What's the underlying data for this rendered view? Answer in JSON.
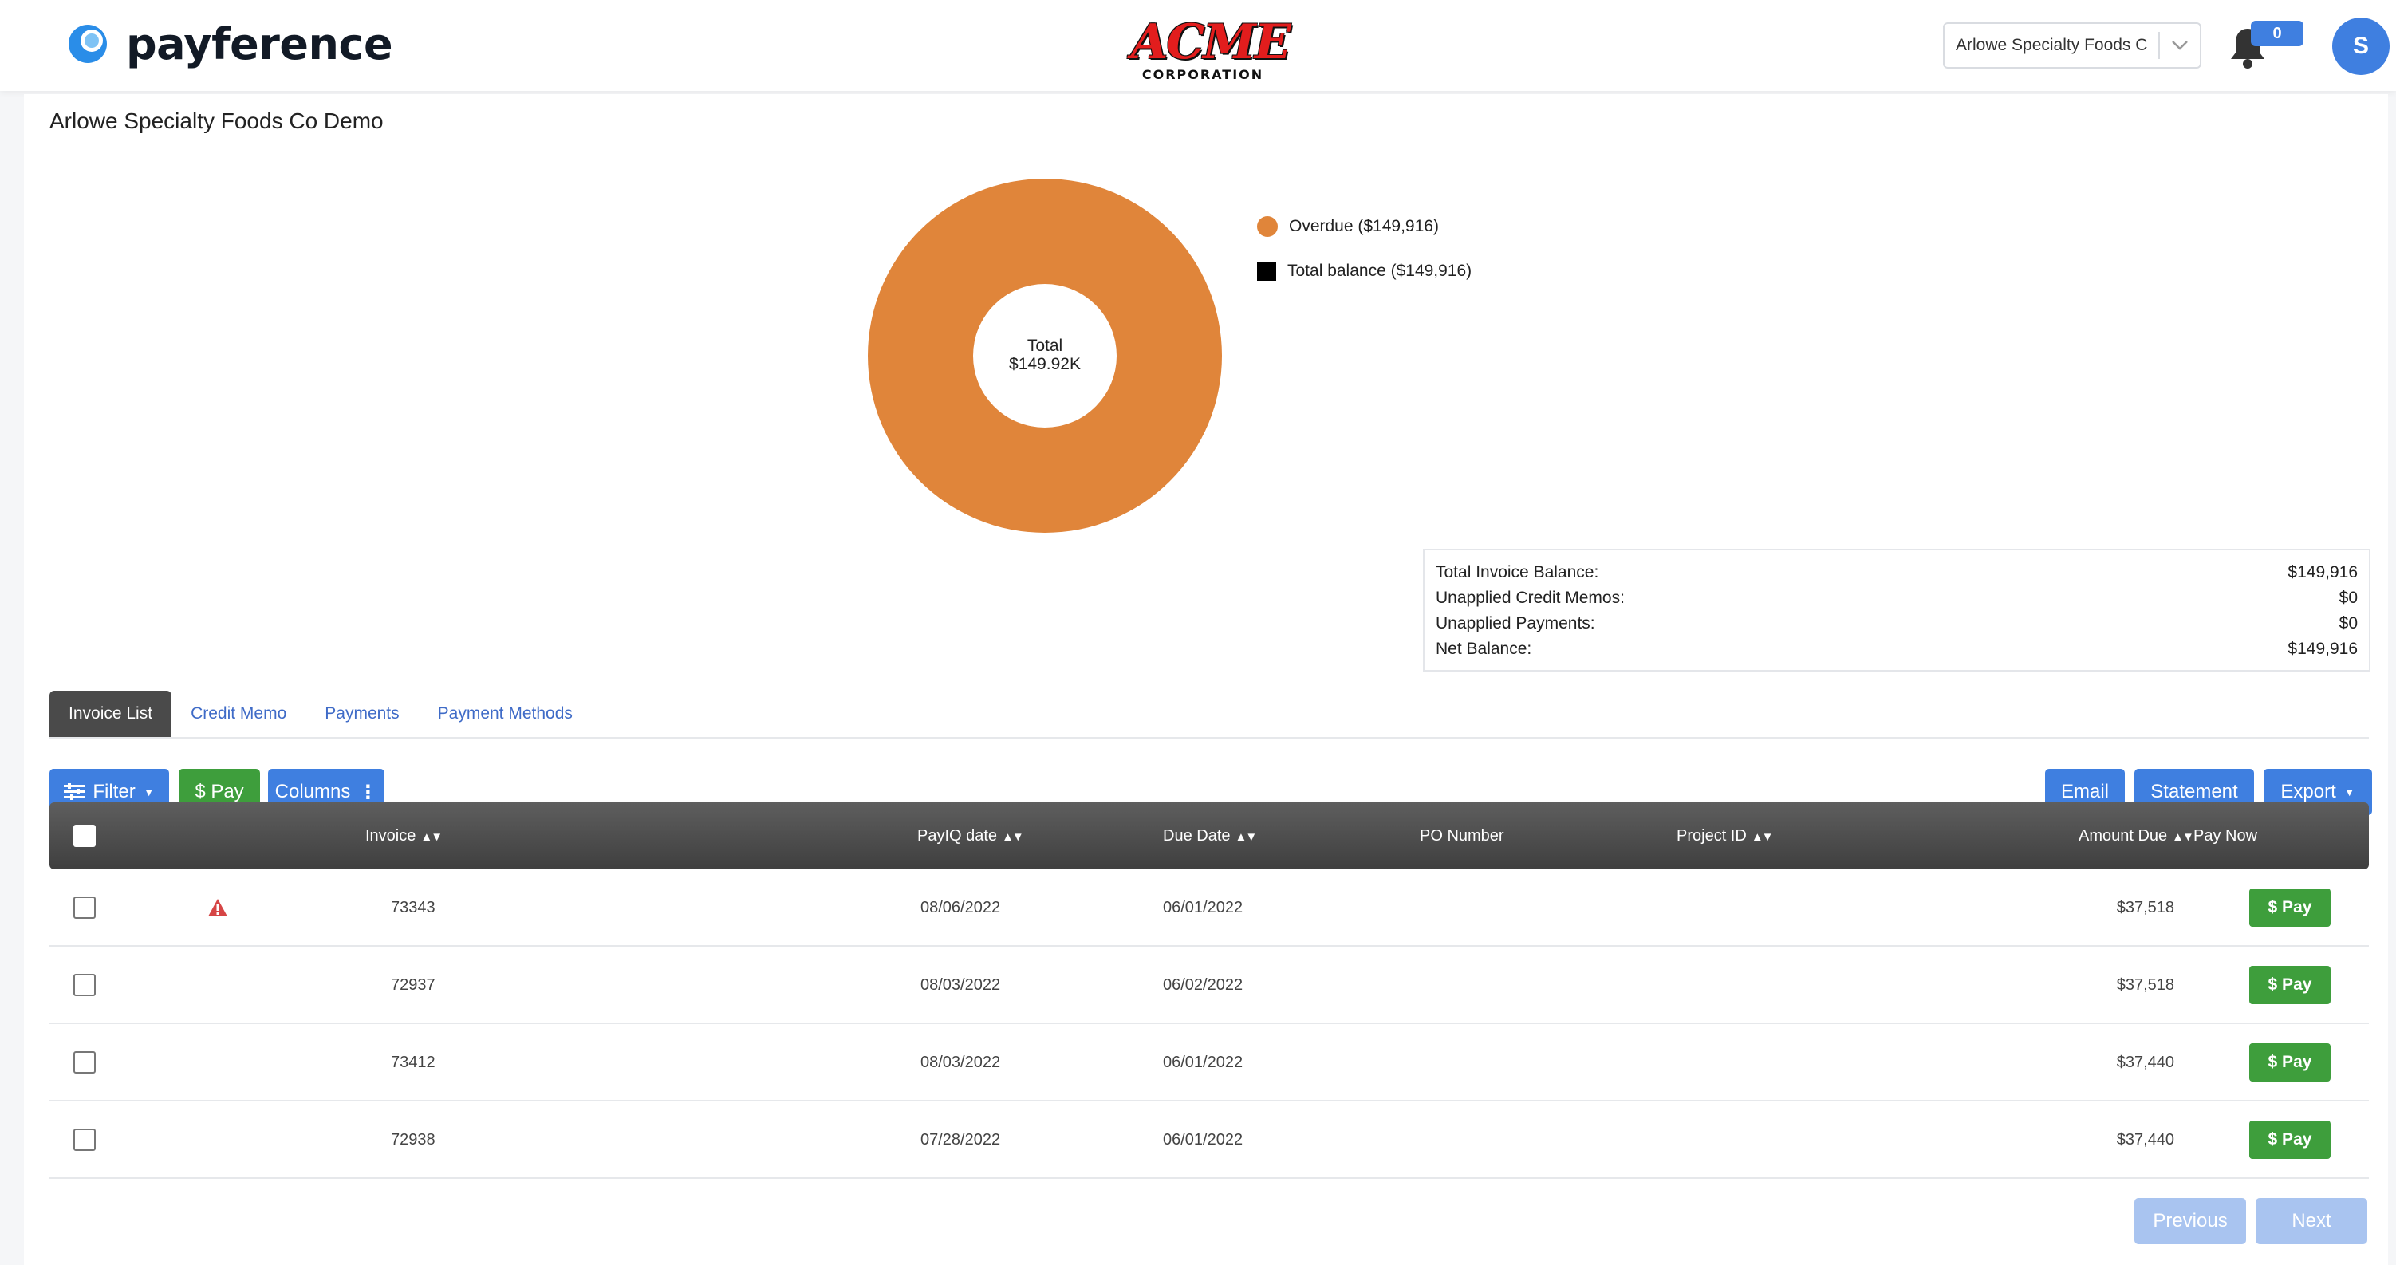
{
  "header": {
    "brand": "payference",
    "company_logo_main": "ACME",
    "company_logo_sub": "CORPORATION",
    "company_select_value": "Arlowe Specialty Foods C...",
    "notifications_count": "0",
    "avatar_initial": "S"
  },
  "page": {
    "title": "Arlowe Specialty Foods Co Demo"
  },
  "chart_data": {
    "type": "pie",
    "center_label_line1": "Total",
    "center_label_line2": "$149.92K",
    "slices": [
      {
        "name": "Overdue ($149,916)",
        "value": 149916,
        "color": "#e0853a"
      }
    ],
    "legend": [
      {
        "label": "Overdue ($149,916)",
        "color": "#e0853a",
        "shape": "circle"
      },
      {
        "label": "Total balance ($149,916)",
        "color": "#000000",
        "shape": "square"
      }
    ]
  },
  "summary": {
    "rows": [
      {
        "label": "Total Invoice Balance:",
        "value": "$149,916"
      },
      {
        "label": "Unapplied Credit Memos:",
        "value": "$0"
      },
      {
        "label": "Unapplied Payments:",
        "value": "$0"
      },
      {
        "label": "Net Balance:",
        "value": "$149,916"
      }
    ]
  },
  "tabs": [
    {
      "label": "Invoice List",
      "active": true
    },
    {
      "label": "Credit Memo"
    },
    {
      "label": "Payments"
    },
    {
      "label": "Payment Methods"
    }
  ],
  "toolbar": {
    "filter_label": "Filter",
    "pay_label": "$ Pay",
    "columns_label": "Columns",
    "email_label": "Email",
    "statement_label": "Statement",
    "export_label": "Export"
  },
  "table": {
    "headers": {
      "invoice": "Invoice",
      "payiq_date": "PayIQ date",
      "due_date": "Due Date",
      "po_number": "PO Number",
      "project_id": "Project ID",
      "amount_due": "Amount Due",
      "pay_now": "Pay Now"
    },
    "pay_button_label": "$ Pay",
    "rows": [
      {
        "invoice": "73343",
        "payiq_date": "08/06/2022",
        "due_date": "06/01/2022",
        "amount_due": "$37,518",
        "warning": true
      },
      {
        "invoice": "72937",
        "payiq_date": "08/03/2022",
        "due_date": "06/02/2022",
        "amount_due": "$37,518",
        "warning": false
      },
      {
        "invoice": "73412",
        "payiq_date": "08/03/2022",
        "due_date": "06/01/2022",
        "amount_due": "$37,440",
        "warning": false
      },
      {
        "invoice": "72938",
        "payiq_date": "07/28/2022",
        "due_date": "06/01/2022",
        "amount_due": "$37,440",
        "warning": false
      }
    ]
  },
  "pagination": {
    "previous_label": "Previous",
    "next_label": "Next"
  },
  "colors": {
    "accent_blue": "#3f7fe0",
    "pay_green": "#3e9e3c",
    "overdue_orange": "#e0853a"
  }
}
